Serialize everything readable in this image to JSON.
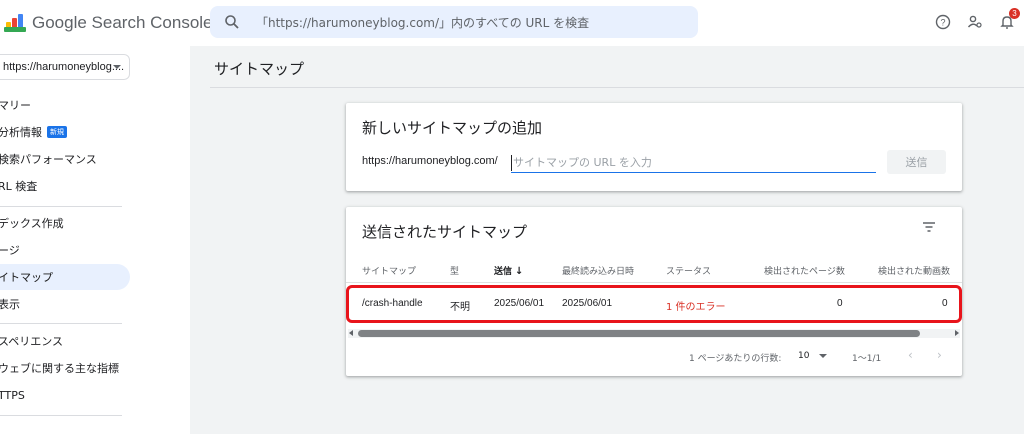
{
  "app": {
    "title": "Google Search Console"
  },
  "search": {
    "placeholder": "「https://harumoneyblog.com/」内のすべての URL を検査"
  },
  "header": {
    "notification_count": "3"
  },
  "sidebar": {
    "property": "https://harumoneyblog....",
    "items": [
      {
        "label": "マリー"
      },
      {
        "label": "分析情報",
        "badge": "新規"
      },
      {
        "label": "検索パフォーマンス"
      },
      {
        "label": "RL 検査"
      },
      {
        "label": "デックス作成"
      },
      {
        "label": "ージ"
      },
      {
        "label": "イトマップ"
      },
      {
        "label": "表示"
      },
      {
        "label": "スペリエンス"
      },
      {
        "label": "ウェブに関する主な指標"
      },
      {
        "label": "TTPS"
      }
    ]
  },
  "page": {
    "title": "サイトマップ"
  },
  "add_card": {
    "title": "新しいサイトマップの追加",
    "url_prefix": "https://harumoneyblog.com/",
    "input_placeholder": "サイトマップの URL を入力",
    "submit_label": "送信"
  },
  "submitted_card": {
    "title": "送信されたサイトマップ",
    "columns": [
      "サイトマップ",
      "型",
      "送信",
      "最終読み込み日時",
      "ステータス",
      "検出されたページ数",
      "検出された動画数"
    ],
    "sort_indicator": "↓",
    "rows": [
      {
        "sitemap": "/crash-handle",
        "type": "不明",
        "submitted": "2025/06/01",
        "last_read": "2025/06/01",
        "status": "1 件のエラー",
        "pages": "0",
        "videos": "0"
      }
    ],
    "pagination": {
      "rows_per_page_label": "1 ページあたりの行数:",
      "rows_per_page": "10",
      "range": "1〜1/1",
      "prev": "‹",
      "next": "›"
    }
  },
  "colors": {
    "accent": "#1a73e8",
    "error": "#d93025",
    "highlight": "#e8141b"
  }
}
